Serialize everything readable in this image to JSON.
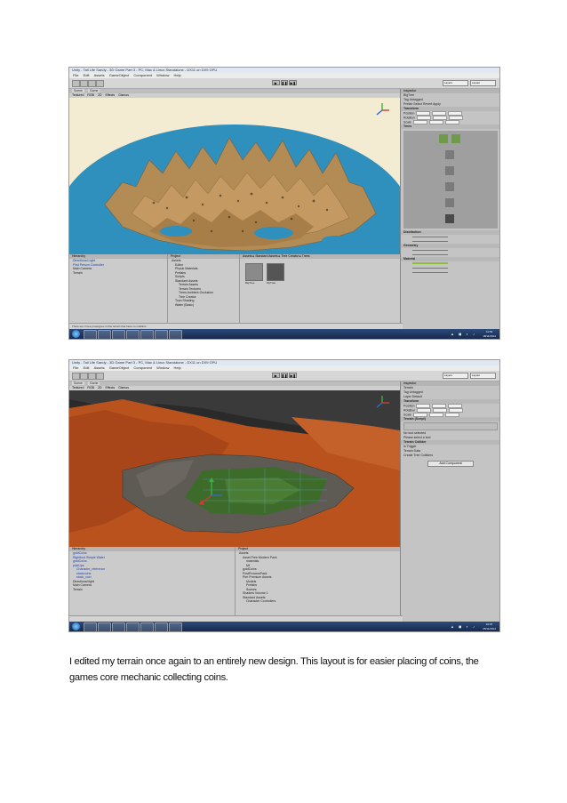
{
  "caption": "I edited my terrain once again to an entirely new design. This layout is for easier placing of coins, the games core mechanic collecting coins.",
  "screens": [
    {
      "title": "Unity - Tall Life Sandy - 3D Game Part 3 - PC, Mac & Linux Standalone - DX11 on DX9 GPU",
      "menu": [
        "File",
        "Edit",
        "Assets",
        "GameObject",
        "Component",
        "Window",
        "Help"
      ],
      "scene_tabs": [
        "Scene",
        "Game"
      ],
      "scene_bar": [
        "Textured",
        "RGB",
        "2D",
        "Effects",
        "Gizmos"
      ],
      "layers": "Layers",
      "layout": "Layout",
      "inspector_tab": "Inspector",
      "object_name": "BigTree",
      "inspector_rows": [
        "Tag Untagged",
        "Prefab Select Revert Apply",
        "Transform",
        "Position",
        "Rotation",
        "Scale",
        "Trees",
        "Distribution",
        "Geometry",
        "Material"
      ],
      "hierarchy_tab": "Hierarchy",
      "hierarchy_items": [
        "Directional Light",
        "First Person Controller",
        "Main Camera",
        "Terrain"
      ],
      "project_tab": "Project",
      "project_items": [
        "Assets",
        "Editor",
        "Physic Materials",
        "Prefabs",
        "Scripts",
        "Standard Assets",
        "Terrain Assets",
        "Terrain Textures",
        "Trees Ambient-Occlusion",
        "Tree Creator",
        "Toon Shading",
        "Water (Basic)"
      ],
      "asset_path": "Assets ▸ Standard Assets ▸ Tree Creator ▸ Trees",
      "asset_tiles": [
        "BigTree",
        "MyTree"
      ],
      "status": "There are 4 tree prototypes in this terrain that have no colliders",
      "clock": [
        "11:54",
        "18/11/2014"
      ]
    },
    {
      "title": "Unity - Tall Life Sandy - 3D Game Part 3 - PC, Mac & Linux Standalone - DX11 on DX9 GPU",
      "menu": [
        "File",
        "Edit",
        "Assets",
        "GameObject",
        "Component",
        "Window",
        "Help"
      ],
      "scene_tabs": [
        "Scene",
        "Game"
      ],
      "scene_bar": [
        "Textured",
        "RGB",
        "2D",
        "Effects",
        "Gizmos"
      ],
      "layers": "Layers",
      "layout": "Layout",
      "inspector_tab": "Inspector",
      "object_name": "Terrain",
      "inspector_rows": [
        "Tag Untagged",
        "Layer Default",
        "Transform",
        "Position",
        "Rotation",
        "Scale",
        "Terrain (Script)",
        "No tool selected",
        "Please select a tool",
        "Terrain Collider",
        "Is Trigger",
        "Terrain Data",
        "Create Tree Colliders"
      ],
      "add_component": "Add Component",
      "hierarchy_tab": "Hierarchy",
      "hierarchy_items": [
        "goldCoins",
        "Rightfoot Simple Water",
        "goldCoins",
        "pickUps",
        "Character_reference",
        "stockcoins",
        "stock_coin",
        "Directional light",
        "Main Camera",
        "Terrain"
      ],
      "project_tab": "Project",
      "project_items": [
        "Assets",
        "Asset Free Modern Pack",
        "materials",
        "Mf",
        "goldCoins",
        "PostProcessPack",
        "Pier Premium Assets",
        "Models",
        "Prefabs",
        "Scenes",
        "Shaders Volume 1",
        "Standard Assets",
        "Character Controllers"
      ],
      "status": "",
      "clock": [
        "10:07",
        "25/11/2014"
      ]
    }
  ],
  "colors": {
    "sky1": "#f6f0d8",
    "water1": "#2b8fb8",
    "mountain1": "#b08a52",
    "ground2": "#b8551c",
    "grass2": "#3d6b2a"
  }
}
